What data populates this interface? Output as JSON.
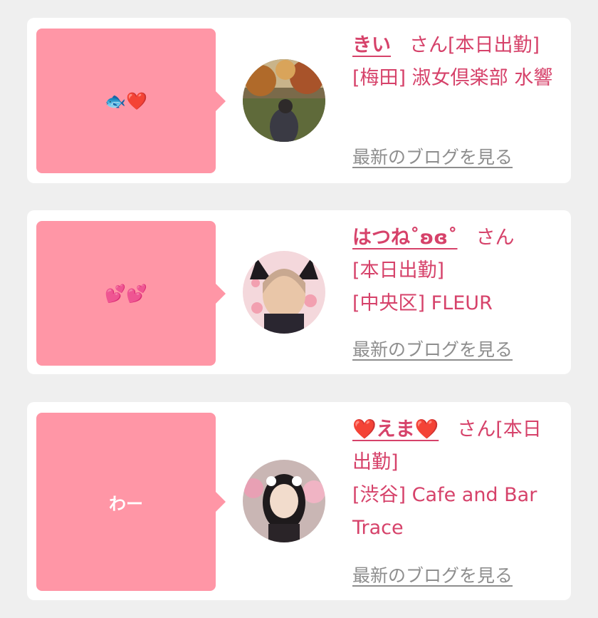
{
  "blog_link_label": "最新のブログを見る",
  "posts": [
    {
      "comment": "🐟❤️",
      "name": "きい",
      "honorific": "さん",
      "status": "[本日出勤]",
      "area": "[梅田]",
      "shop": "淑女倶楽部 水響"
    },
    {
      "comment": "💕💕",
      "name": "はつね˚ʚɞ˚",
      "honorific": "さん",
      "status": "[本日出勤]",
      "area": "[中央区]",
      "shop": "FLEUR"
    },
    {
      "comment": "わー",
      "name": "❤️えま❤️",
      "honorific": "さん",
      "status": "[本日出勤]",
      "area": "[渋谷]",
      "shop": "Cafe and Bar Trace"
    }
  ],
  "colors": {
    "accent": "#d6426a",
    "bubble": "#ff96a6",
    "link": "#8e8e8e",
    "background": "#efefef"
  }
}
